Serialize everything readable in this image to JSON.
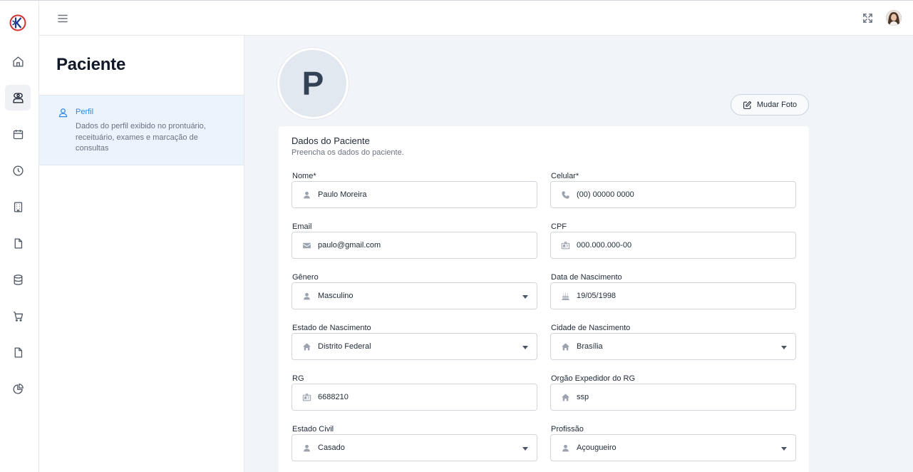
{
  "nav": {
    "items": [
      {
        "icon": "home-icon"
      },
      {
        "icon": "users-icon",
        "active": true
      },
      {
        "icon": "calendar-icon"
      },
      {
        "icon": "clock-icon"
      },
      {
        "icon": "building-icon"
      },
      {
        "icon": "file-icon"
      },
      {
        "icon": "database-icon"
      },
      {
        "icon": "cart-icon"
      },
      {
        "icon": "document-icon"
      },
      {
        "icon": "pie-chart-icon"
      }
    ]
  },
  "panel": {
    "title": "Paciente",
    "section": {
      "title": "Perfil",
      "description": "Dados do perfil exibido no prontuário, receituário, exames e marcação de consultas"
    }
  },
  "photo": {
    "initial": "P",
    "button_label": "Mudar Foto"
  },
  "form": {
    "title": "Dados do Paciente",
    "subtitle": "Preencha os dados do paciente.",
    "fields": {
      "nome": {
        "label": "Nome*",
        "value": "Paulo Moreira",
        "icon": "user-icon"
      },
      "celular": {
        "label": "Celular*",
        "value": "(00) 00000 0000",
        "icon": "phone-icon"
      },
      "email": {
        "label": "Email",
        "value": "paulo@gmail.com",
        "icon": "mail-icon"
      },
      "cpf": {
        "label": "CPF",
        "value": "000.000.000-00",
        "icon": "id-card-icon"
      },
      "genero": {
        "label": "Gênero",
        "value": "Masculino",
        "icon": "user-icon",
        "select": true
      },
      "nascimento": {
        "label": "Data de Nascimento",
        "value": "19/05/1998",
        "icon": "cake-icon"
      },
      "estado_nascimento": {
        "label": "Estado de Nascimento",
        "value": "Distrito Federal",
        "icon": "home-fill-icon",
        "select": true
      },
      "cidade_nascimento": {
        "label": "Cidade de Nascimento",
        "value": "Brasília",
        "icon": "home-fill-icon",
        "select": true
      },
      "rg": {
        "label": "RG",
        "value": "6688210",
        "icon": "id-card-icon"
      },
      "orgao_rg": {
        "label": "Orgão Expedidor do RG",
        "value": "ssp",
        "icon": "home-fill-icon"
      },
      "estado_civil": {
        "label": "Estado Civil",
        "value": "Casado",
        "icon": "user-icon",
        "select": true
      },
      "profissao": {
        "label": "Profissão",
        "value": "Açougueiro",
        "icon": "user-icon",
        "select": true
      }
    }
  }
}
